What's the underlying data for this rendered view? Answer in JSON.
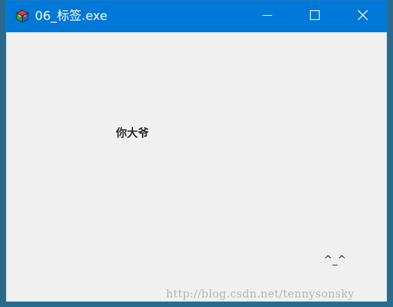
{
  "window": {
    "title": "06_标签.exe",
    "icon": "app-cube-icon",
    "controls": {
      "minimize_icon": "minimize-icon",
      "maximize_icon": "maximize-icon",
      "close_icon": "close-icon"
    }
  },
  "content": {
    "label_text": "你大爷",
    "face_text": "^_^"
  },
  "watermark": "http://blog.csdn.net/tennysonsky",
  "colors": {
    "titlebar": "#0078d7",
    "client_background": "#f0f0f0",
    "label_text": "#2a2a2a",
    "watermark": "#b4b4b4"
  }
}
